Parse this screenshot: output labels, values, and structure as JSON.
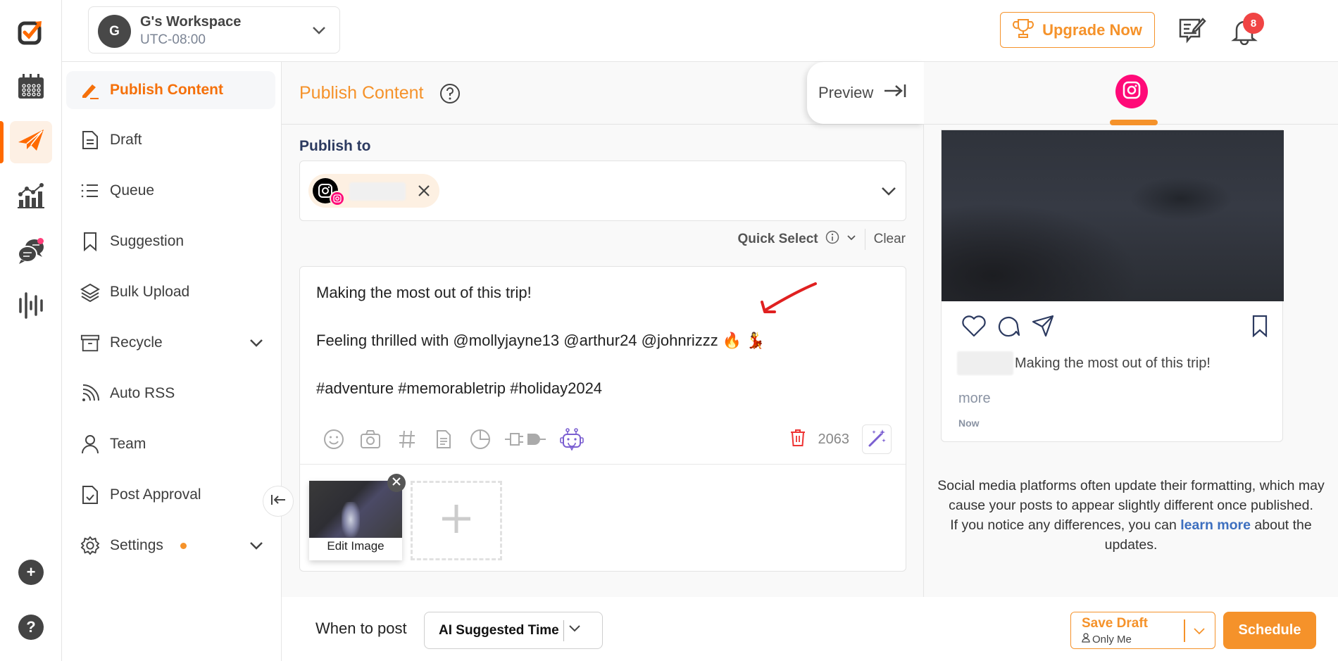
{
  "rail": {
    "items": [
      {
        "name": "calendar",
        "active": false
      },
      {
        "name": "publish",
        "active": true
      },
      {
        "name": "analytics",
        "active": false
      },
      {
        "name": "inbox",
        "active": false,
        "has_notification": true
      },
      {
        "name": "listening",
        "active": false
      }
    ],
    "add_label": "+",
    "help_label": "?"
  },
  "header": {
    "workspace": {
      "initial": "G",
      "name": "G's Workspace",
      "timezone": "UTC-08:00"
    },
    "upgrade_label": "Upgrade Now",
    "notification_count": "8"
  },
  "sidebar": {
    "items": [
      {
        "label": "Publish Content",
        "icon": "pencil-icon",
        "active": true
      },
      {
        "label": "Draft",
        "icon": "document-icon"
      },
      {
        "label": "Queue",
        "icon": "list-icon"
      },
      {
        "label": "Suggestion",
        "icon": "bookmark-icon"
      },
      {
        "label": "Bulk Upload",
        "icon": "layers-icon"
      },
      {
        "label": "Recycle",
        "icon": "archive-icon",
        "expandable": true
      },
      {
        "label": "Auto RSS",
        "icon": "rss-icon"
      },
      {
        "label": "Team",
        "icon": "user-icon"
      },
      {
        "label": "Post Approval",
        "icon": "file-check-icon"
      },
      {
        "label": "Settings",
        "icon": "gear-icon",
        "expandable": true,
        "has_dot": true
      }
    ]
  },
  "editor": {
    "title": "Publish Content",
    "preview_label": "Preview",
    "publish_to_label": "Publish to",
    "selected_account": {
      "platform": "Instagram",
      "name_redacted": true
    },
    "quick_select_label": "Quick Select",
    "clear_label": "Clear",
    "post_text": "Making the most out of this trip!\n\nFeeling thrilled with @mollyjayne13 @arthur24 @johnrizzz 🔥 💃\n\n#adventure #memorabletrip #holiday2024",
    "char_count": "2063",
    "toolbar": [
      "emoji-icon",
      "camera-icon",
      "hashtag-icon",
      "template-icon",
      "chart-icon",
      "plug-icon",
      "ai-robot-icon"
    ],
    "media": [
      {
        "label": "Edit Image"
      }
    ],
    "add_media_label": "+"
  },
  "preview": {
    "platform": "Instagram",
    "caption": "Making the most out of this trip!",
    "more_label": "more",
    "time_label": "Now",
    "note_text": "Social media platforms often update their formatting, which may cause your posts to appear slightly different once published.",
    "note_text2_before": "If you notice any differences, you can",
    "note_link": "learn more",
    "note_text2_after": "about the updates."
  },
  "bottom": {
    "when_label": "When to post",
    "when_value": "AI Suggested Time",
    "save_draft_label": "Save Draft",
    "save_draft_visibility": "Only Me",
    "schedule_label": "Schedule"
  },
  "colors": {
    "accent": "#f5922a",
    "accent_active": "#f5700a",
    "instagram": "#ff0a78",
    "notification": "#f04444",
    "link": "#3d6fbf",
    "heading": "#2c3a60"
  }
}
